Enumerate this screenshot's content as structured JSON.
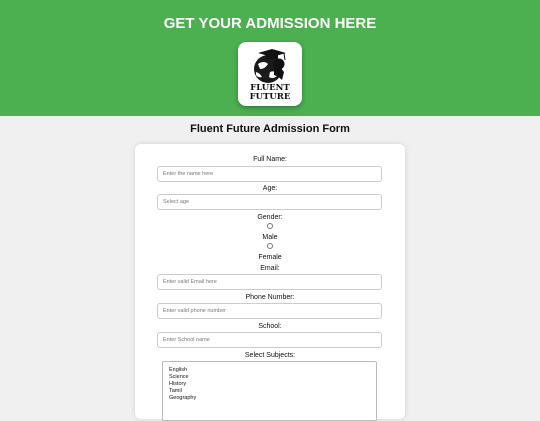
{
  "header": {
    "title": "GET YOUR ADMISSION HERE",
    "logo_text_line1": "FLUENT",
    "logo_text_line2": "FUTURE"
  },
  "form": {
    "title": "Fluent Future Admission Form",
    "full_name": {
      "label": "Full Name:",
      "placeholder": "Enter the name here"
    },
    "age": {
      "label": "Age:",
      "placeholder": "Select age"
    },
    "gender": {
      "label": "Gender:",
      "options": [
        {
          "label": "Male",
          "selected": false
        },
        {
          "label": "Female",
          "selected": false
        }
      ]
    },
    "email": {
      "label": "Email:",
      "placeholder": "Enter valid Email here"
    },
    "phone": {
      "label": "Phone Number:",
      "placeholder": "Enter valid phone number"
    },
    "school": {
      "label": "School:",
      "placeholder": "Enter School name"
    },
    "subjects": {
      "label": "Select Subjects:",
      "options": [
        "English",
        "Science",
        "History",
        "Tamil",
        "Geography"
      ]
    }
  },
  "colors": {
    "banner": "#4caf50",
    "page_background": "#f0f0f0",
    "card": "#ffffff"
  },
  "icons": {
    "logo": "graduate-globe-logo",
    "radio": "radio-button"
  }
}
